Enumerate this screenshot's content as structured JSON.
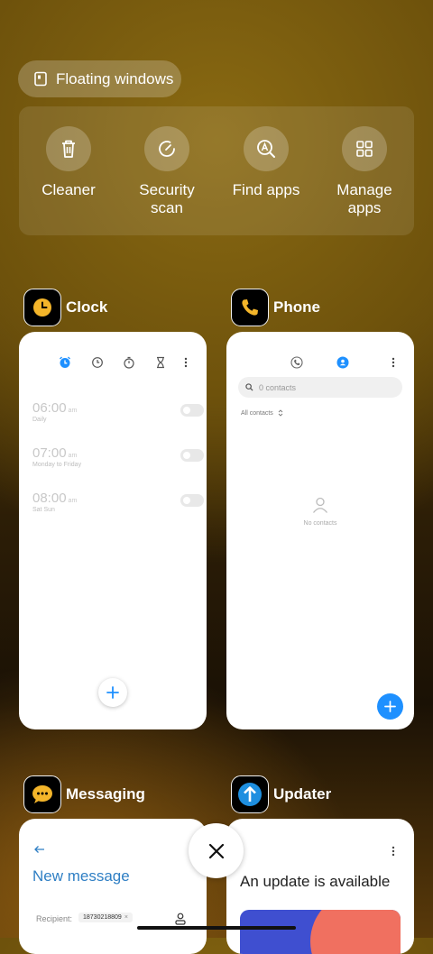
{
  "floating_windows": {
    "label": "Floating windows",
    "icon": "floating-window-icon"
  },
  "tools": [
    {
      "label": "Cleaner",
      "icon": "trash-icon"
    },
    {
      "label": "Security\nscan",
      "icon": "security-scan-icon"
    },
    {
      "label": "Find apps",
      "icon": "find-apps-icon"
    },
    {
      "label": "Manage\napps",
      "icon": "grid-icon"
    }
  ],
  "apps": {
    "clock": {
      "name": "Clock",
      "alarms": [
        {
          "time": "06:00",
          "ampm": "am",
          "repeat": "Daily"
        },
        {
          "time": "07:00",
          "ampm": "am",
          "repeat": "Monday to Friday"
        },
        {
          "time": "08:00",
          "ampm": "am",
          "repeat": "Sat Sun"
        }
      ]
    },
    "phone": {
      "name": "Phone",
      "search_placeholder": "0 contacts",
      "filter": "All contacts",
      "empty": "No contacts"
    },
    "messaging": {
      "name": "Messaging",
      "title": "New message",
      "recipient_label": "Recipient:",
      "recipient": "18730218809"
    },
    "updater": {
      "name": "Updater",
      "title": "An update is available"
    }
  },
  "colors": {
    "accent": "#1e90ff",
    "clock_icon": "#f4b52a",
    "phone_icon": "#f4b52a",
    "updater_icon": "#1e8fe0"
  }
}
